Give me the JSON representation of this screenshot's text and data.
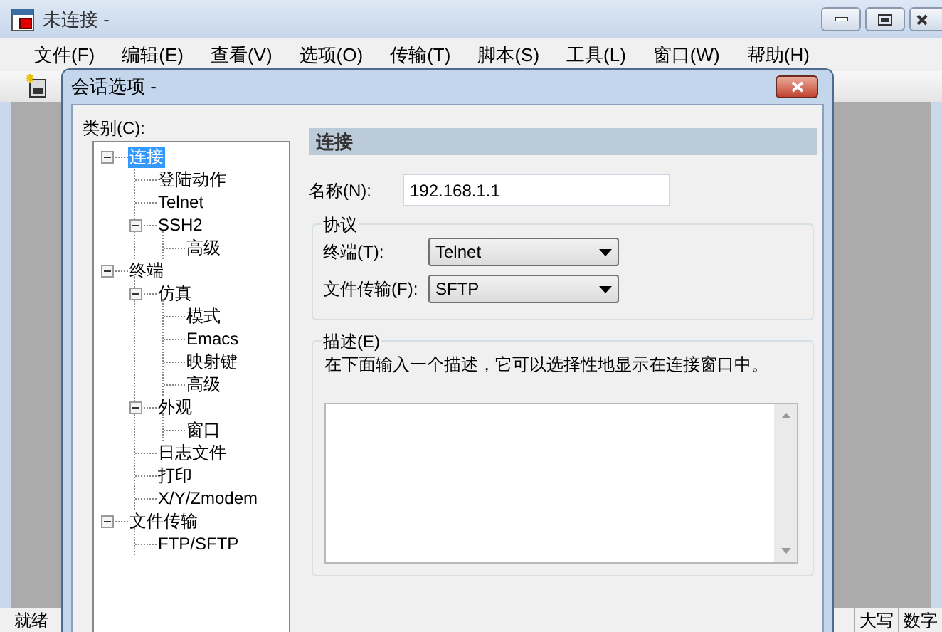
{
  "window": {
    "title": "未连接 -"
  },
  "menu": [
    "文件(F)",
    "编辑(E)",
    "查看(V)",
    "选项(O)",
    "传输(T)",
    "脚本(S)",
    "工具(L)",
    "窗口(W)",
    "帮助(H)"
  ],
  "dialog": {
    "title": "会话选项 -",
    "category_label": "类别(C):",
    "tree": [
      {
        "label": "连接",
        "selected": true,
        "expanded": true,
        "children": [
          {
            "label": "登陆动作",
            "selected": false
          },
          {
            "label": "Telnet",
            "selected": false
          },
          {
            "label": "SSH2",
            "selected": false,
            "expanded": true,
            "children": [
              {
                "label": "高级",
                "selected": false
              }
            ]
          }
        ]
      },
      {
        "label": "终端",
        "selected": false,
        "expanded": true,
        "children": [
          {
            "label": "仿真",
            "selected": false,
            "expanded": true,
            "children": [
              {
                "label": "模式",
                "selected": false
              },
              {
                "label": "Emacs",
                "selected": false
              },
              {
                "label": "映射键",
                "selected": false
              },
              {
                "label": "高级",
                "selected": false
              }
            ]
          },
          {
            "label": "外观",
            "selected": false,
            "expanded": true,
            "children": [
              {
                "label": "窗口",
                "selected": false
              }
            ]
          },
          {
            "label": "日志文件",
            "selected": false
          },
          {
            "label": "打印",
            "selected": false
          },
          {
            "label": "X/Y/Zmodem",
            "selected": false
          }
        ]
      },
      {
        "label": "文件传输",
        "selected": false,
        "expanded": true,
        "children": [
          {
            "label": "FTP/SFTP",
            "selected": false
          }
        ]
      }
    ],
    "panel": {
      "heading": "连接",
      "name": {
        "label": "名称(N):",
        "value": "192.168.1.1"
      },
      "protocol": {
        "title": "协议",
        "fields": [
          {
            "label": "终端(T):",
            "value": "Telnet"
          },
          {
            "label": "文件传输(F):",
            "value": "SFTP"
          }
        ]
      },
      "description": {
        "title": "描述(E)",
        "hint": "在下面输入一个描述，它可以选择性地显示在连接窗口中。"
      }
    }
  },
  "status_bar": {
    "text": "就绪",
    "indicators": [
      "大写",
      "数字"
    ]
  }
}
